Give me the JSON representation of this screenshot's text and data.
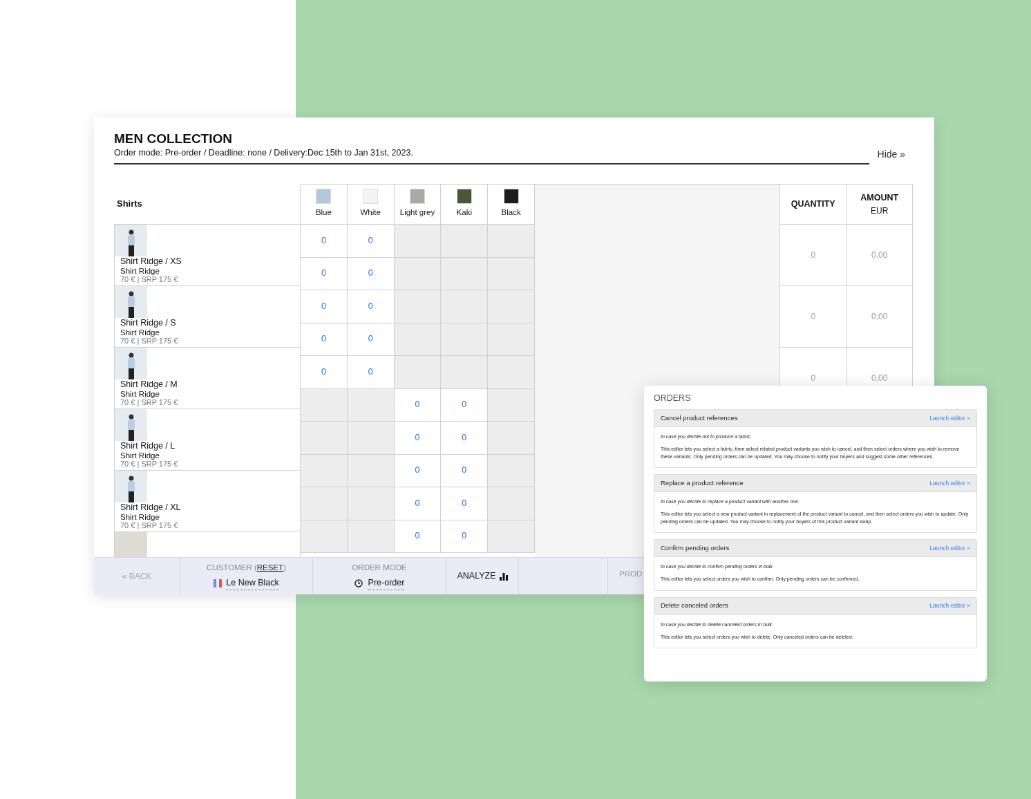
{
  "header": {
    "title": "MEN COLLECTION",
    "subtitle": "Order mode: Pre-order / Deadline: none / Delivery:Dec 15th to Jan 31st, 2023.",
    "hide_link": "Hide »"
  },
  "table": {
    "category": "Shirts",
    "colors": [
      {
        "label": "Blue",
        "color": "#b4c8dc"
      },
      {
        "label": "White",
        "color": "#f4f4f4"
      },
      {
        "label": "Light grey",
        "color": "#a9a9a6"
      },
      {
        "label": "Kaki",
        "color": "#4d5537"
      },
      {
        "label": "Black",
        "color": "#1c1c1c"
      }
    ],
    "quantity_header": "QUANTITY",
    "amount_header": "AMOUNT",
    "amount_currency": "EUR",
    "products": [
      {
        "title": "Shirt Ridge / XS",
        "name": "Shirt Ridge",
        "price": "70 € | SRP 175 €"
      },
      {
        "title": "Shirt Ridge / S",
        "name": "Shirt Ridge",
        "price": "70 € | SRP 175 €"
      },
      {
        "title": "Shirt Ridge / M",
        "name": "Shirt Ridge",
        "price": "70 € | SRP 175 €"
      },
      {
        "title": "Shirt Ridge / L",
        "name": "Shirt Ridge",
        "price": "70 € | SRP 175 €"
      },
      {
        "title": "Shirt Ridge / XL",
        "name": "Shirt Ridge",
        "price": "70 € | SRP 175 €"
      }
    ],
    "grid_rows": [
      {
        "cells": [
          {
            "disabled": false,
            "value": "0"
          },
          {
            "disabled": false,
            "value": "0"
          },
          {
            "disabled": true
          },
          {
            "disabled": true
          },
          {
            "disabled": true
          }
        ]
      },
      {
        "cells": [
          {
            "disabled": false,
            "value": "0"
          },
          {
            "disabled": false,
            "value": "0"
          },
          {
            "disabled": true
          },
          {
            "disabled": true
          },
          {
            "disabled": true
          }
        ]
      },
      {
        "cells": [
          {
            "disabled": false,
            "value": "0"
          },
          {
            "disabled": false,
            "value": "0"
          },
          {
            "disabled": true
          },
          {
            "disabled": true
          },
          {
            "disabled": true
          }
        ]
      },
      {
        "cells": [
          {
            "disabled": false,
            "value": "0"
          },
          {
            "disabled": false,
            "value": "0"
          },
          {
            "disabled": true
          },
          {
            "disabled": true
          },
          {
            "disabled": true
          }
        ]
      },
      {
        "cells": [
          {
            "disabled": false,
            "value": "0"
          },
          {
            "disabled": false,
            "value": "0"
          },
          {
            "disabled": true
          },
          {
            "disabled": true
          },
          {
            "disabled": true
          }
        ]
      },
      {
        "cells": [
          {
            "disabled": true
          },
          {
            "disabled": true
          },
          {
            "disabled": false,
            "value": "0"
          },
          {
            "disabled": false,
            "value": "0"
          },
          {
            "disabled": true
          }
        ]
      },
      {
        "cells": [
          {
            "disabled": true
          },
          {
            "disabled": true
          },
          {
            "disabled": false,
            "value": "0"
          },
          {
            "disabled": false,
            "value": "0"
          },
          {
            "disabled": true
          }
        ]
      },
      {
        "cells": [
          {
            "disabled": true
          },
          {
            "disabled": true
          },
          {
            "disabled": false,
            "value": "0"
          },
          {
            "disabled": false,
            "value": "0"
          },
          {
            "disabled": true
          }
        ]
      },
      {
        "cells": [
          {
            "disabled": true
          },
          {
            "disabled": true
          },
          {
            "disabled": false,
            "value": "0"
          },
          {
            "disabled": false,
            "value": "0"
          },
          {
            "disabled": true
          }
        ]
      },
      {
        "cells": [
          {
            "disabled": true
          },
          {
            "disabled": true
          },
          {
            "disabled": false,
            "value": "0"
          },
          {
            "disabled": false,
            "value": "0"
          },
          {
            "disabled": true
          }
        ]
      }
    ],
    "totals": [
      {
        "quantity": "0",
        "amount": "0,00"
      },
      {
        "quantity": "0",
        "amount": "0,00"
      },
      {
        "quantity": "0",
        "amount": "0,00"
      }
    ]
  },
  "bottom_bar": {
    "back": "« BACK",
    "customer_label": "CUSTOMER (",
    "customer_reset": "RESET",
    "customer_close": ")",
    "customer": "Le New Black",
    "order_mode_label": "ORDER MODE",
    "order_mode": "Pre-order",
    "analyze": "ANALYZE",
    "cut_label": "PROD"
  },
  "orders": {
    "title": "ORDERS",
    "sections": [
      {
        "title": "Cancel product references",
        "link": "Launch editor »",
        "intro": "In case you decide not to produce a fabric.",
        "body": "This editor lets you select a fabric, then select related product variants you wish to cancel, and then select orders where you wish to remove these variants. Only pending orders can be updated. You may choose to notify your buyers and suggest some other references."
      },
      {
        "title": "Replace a product reference",
        "link": "Launch editor »",
        "intro": "In case you decide to replace a product variant with another one.",
        "body": "This editor lets you select a new product variant in replacement of the product variant to cancel, and then select orders you wish to update. Only pending orders can be updated. You may choose to notify your buyers of this product variant swap."
      },
      {
        "title": "Confirm pending orders",
        "link": "Launch editor »",
        "intro": "In case you decide to confirm pending orders in bulk.",
        "body": "This editor lets you select orders you wish to confirm. Only pending orders can be confirmed."
      },
      {
        "title": "Delete canceled orders",
        "link": "Launch editor »",
        "intro": "In case you decide to delete canceled orders in bulk.",
        "body": "This editor lets you select orders you wish to delete. Only canceled orders can be deleted."
      }
    ]
  }
}
